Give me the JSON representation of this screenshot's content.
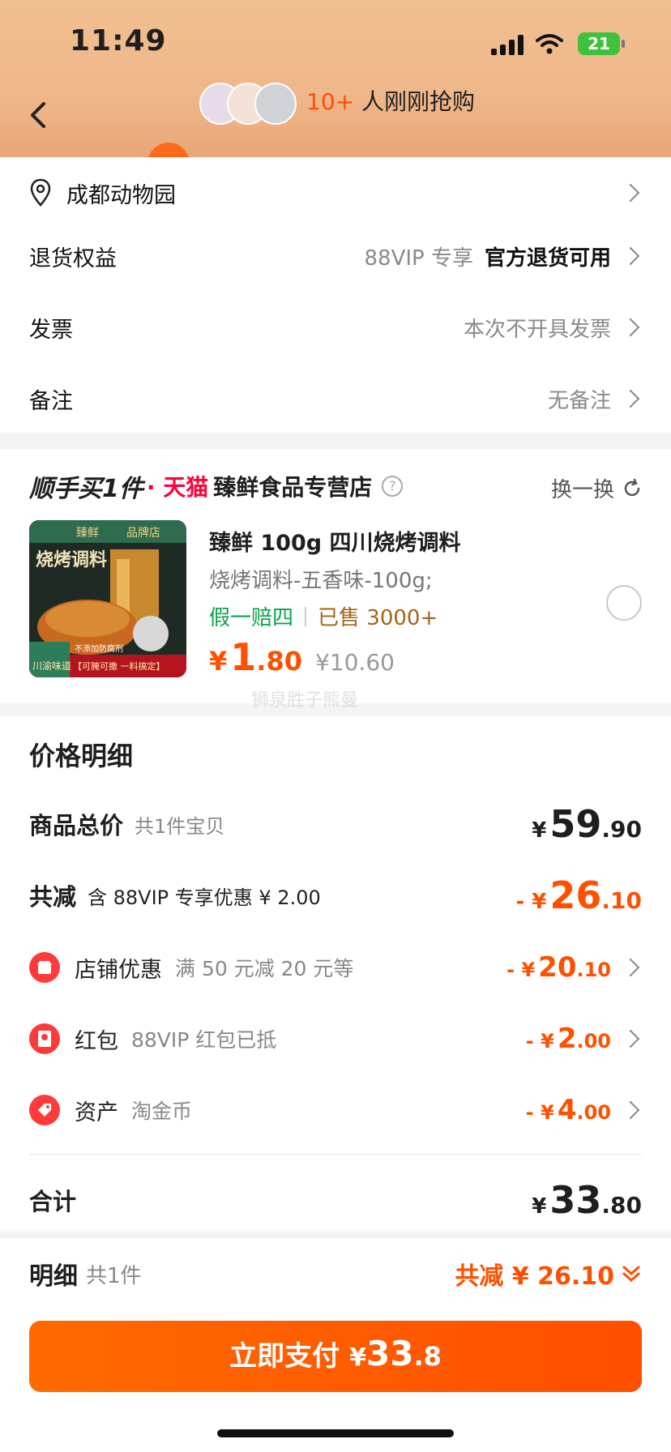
{
  "status_bar": {
    "time": "11:49",
    "battery": "21"
  },
  "header": {
    "buyers_count": "10+",
    "buyers_text": "人刚刚抢购"
  },
  "address": {
    "label": "成都动物园"
  },
  "info_rows": [
    {
      "label": "退货权益",
      "value_muted": "88VIP 专享",
      "value_strong": "官方退货可用"
    },
    {
      "label": "发票",
      "value_muted": "本次不开具发票"
    },
    {
      "label": "备注",
      "value_muted": "无备注"
    }
  ],
  "promo": {
    "title": "顺手买1件",
    "platform": "· 天猫",
    "store": "臻鲜食品专营店",
    "swap": "换一换",
    "product": {
      "name": "臻鲜 100g 四川烧烤调料",
      "spec": "烧烤调料-五香味-100g;",
      "tag_guarantee": "假一赔四",
      "tag_sold": "已售 3000+",
      "price_symbol": "¥",
      "price_int": "1",
      "price_dec": ".80",
      "orig_price": "¥10.60",
      "img_labels": {
        "brand": "臻鲜",
        "shop": "品牌店",
        "title": "烧烤调料",
        "flavor": "川渝味道",
        "slogan": "【可腌可撒 一料搞定】",
        "feature": "不添加防腐剂"
      }
    },
    "watermark": "狮泉胜子熊曼"
  },
  "price_detail": {
    "title": "价格明细",
    "total": {
      "label": "商品总价",
      "note": "共1件宝贝",
      "symbol": "¥",
      "int": "59",
      "dec": ".90"
    },
    "reduce": {
      "label": "共减",
      "note": "含 88VIP 专享优惠 ¥ 2.00",
      "prefix": "- ¥",
      "int": "26",
      "dec": ".10"
    },
    "items": [
      {
        "label": "店铺优惠",
        "note": "满 50 元减 20 元等",
        "prefix": "- ¥",
        "int": "20",
        "dec": ".10",
        "icon": "shop-icon"
      },
      {
        "label": "红包",
        "note": "88VIP 红包已抵",
        "prefix": "- ¥",
        "int": "2",
        "dec": ".00",
        "icon": "red-packet-icon"
      },
      {
        "label": "资产",
        "note": "淘金币",
        "prefix": "- ¥",
        "int": "4",
        "dec": ".00",
        "icon": "coupon-tag-icon"
      }
    ],
    "sum": {
      "label": "合计",
      "symbol": "¥",
      "int": "33",
      "dec": ".80"
    }
  },
  "footer": {
    "label": "明细",
    "count": "共1件",
    "reduce_text": "共减 ¥ 26.10",
    "pay_label": "立即支付",
    "pay_symbol": "¥",
    "pay_int": "33",
    "pay_dec": ".8"
  },
  "colors": {
    "accent": "#ff5000",
    "header_top": "#f1c08f",
    "header_bottom": "#e9a678",
    "green": "#0aa44a"
  }
}
